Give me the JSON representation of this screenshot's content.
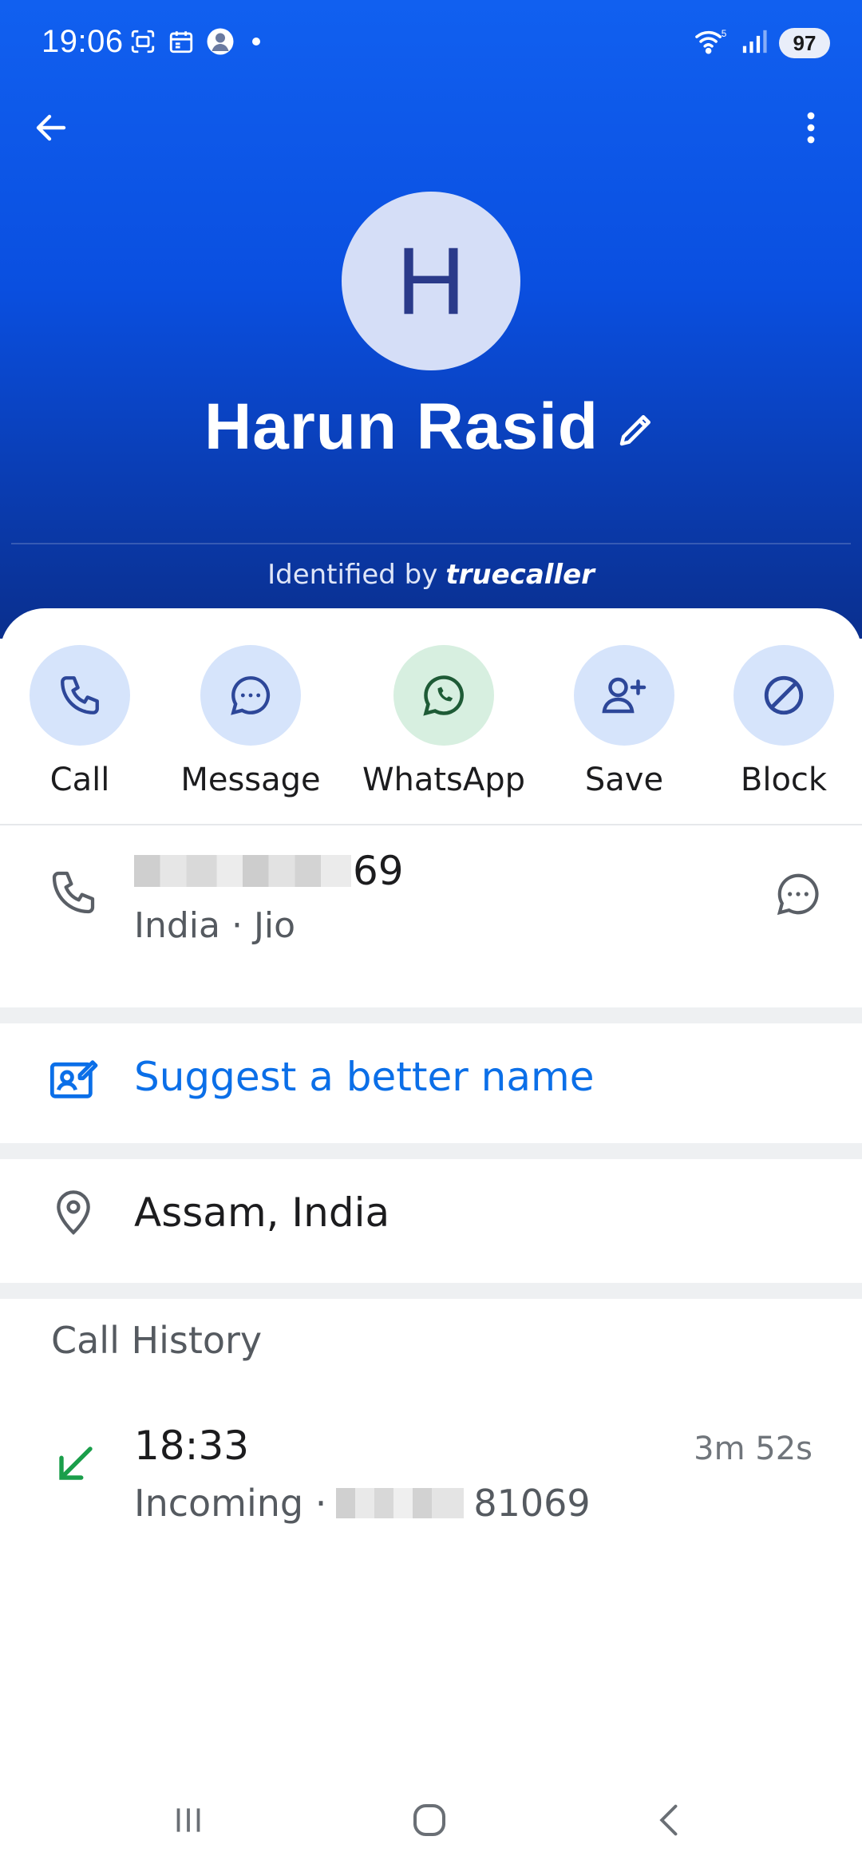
{
  "status_bar": {
    "time": "19:06",
    "battery": "97",
    "icons": [
      "screenshot-icon",
      "calendar-icon",
      "profile-notification-icon",
      "dot-icon",
      "wifi-icon",
      "signal-icon",
      "battery-icon"
    ]
  },
  "header": {
    "avatar_letter": "H",
    "contact_name": "Harun Rasid",
    "identified_prefix": "Identified by",
    "brand": "truecaller",
    "colors": {
      "gradient_top": "#1160f0",
      "gradient_bottom": "#0a2f8e"
    }
  },
  "actions": [
    {
      "label": "Call",
      "icon": "phone-icon"
    },
    {
      "label": "Message",
      "icon": "message-bubble-icon"
    },
    {
      "label": "WhatsApp",
      "icon": "whatsapp-icon"
    },
    {
      "label": "Save",
      "icon": "add-person-icon"
    },
    {
      "label": "Block",
      "icon": "block-icon"
    }
  ],
  "number": {
    "visible_suffix": "69",
    "sub": "India · Jio"
  },
  "suggest": {
    "label": "Suggest a better name"
  },
  "location": {
    "label": "Assam, India"
  },
  "call_history": {
    "title": "Call History",
    "entries": [
      {
        "time": "18:33",
        "type": "Incoming",
        "number_suffix": "81069",
        "duration": "3m 52s"
      }
    ]
  },
  "accent_colors": {
    "link": "#0b6fe8",
    "incoming": "#1a9e4a",
    "action_bg": "#d6e4fb",
    "whatsapp_bg": "#d7efe0"
  }
}
